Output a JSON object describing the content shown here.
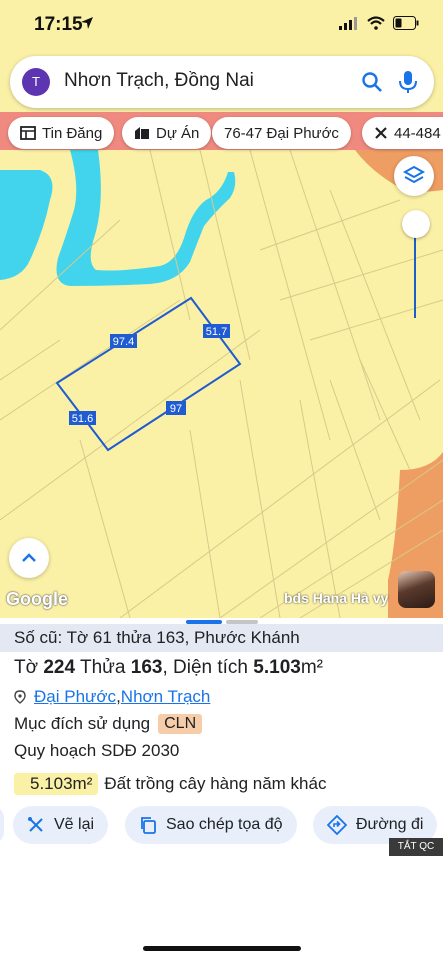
{
  "status_bar": {
    "time": "17:15"
  },
  "search": {
    "avatar_letter": "T",
    "query": "Nhơn Trạch, Đồng Nai"
  },
  "chips": [
    {
      "label": "Tin Đăng",
      "icon": "listing-icon"
    },
    {
      "label": "Dự Án",
      "icon": "building-icon"
    },
    {
      "label": "76-47 Đại Phước",
      "icon": ""
    },
    {
      "label": "44-484",
      "icon": "tools-icon"
    }
  ],
  "map": {
    "edge_labels": [
      "97.4",
      "51.7",
      "97",
      "51.6"
    ],
    "google_logo": "Google",
    "watermark": "bds Hana Hà vy",
    "colors": {
      "land": "#fbf1a6",
      "water": "#42d4ec",
      "road": "#f08a80",
      "parcel_outline": "#1f5bd1",
      "brown_zone": "#ee9e62"
    }
  },
  "sheet": {
    "old_info": "Số cũ: Tờ 61 thửa 163, Phước Khánh",
    "parcel_prefix": "Tờ ",
    "sheet_no": "224",
    "parcel_mid": " Thửa ",
    "parcel_no": "163",
    "area_prefix": ", Diện tích ",
    "area_value": "5.103",
    "area_unit": "m²",
    "ward": "Đại Phước",
    "separator": ", ",
    "district": "Nhơn Trạch",
    "purpose_label": "Mục đích sử dụng",
    "purpose_code": "CLN",
    "zoning_label": "Quy hoạch SDĐ 2030",
    "zoning_area": "5.103m²",
    "zoning_desc": "Đất trồng cây hàng năm khác"
  },
  "actions": {
    "draw": "Vẽ lại",
    "copy": "Sao chép tọa độ",
    "route": "Đường đi"
  },
  "ad_label": "TẮT QC"
}
